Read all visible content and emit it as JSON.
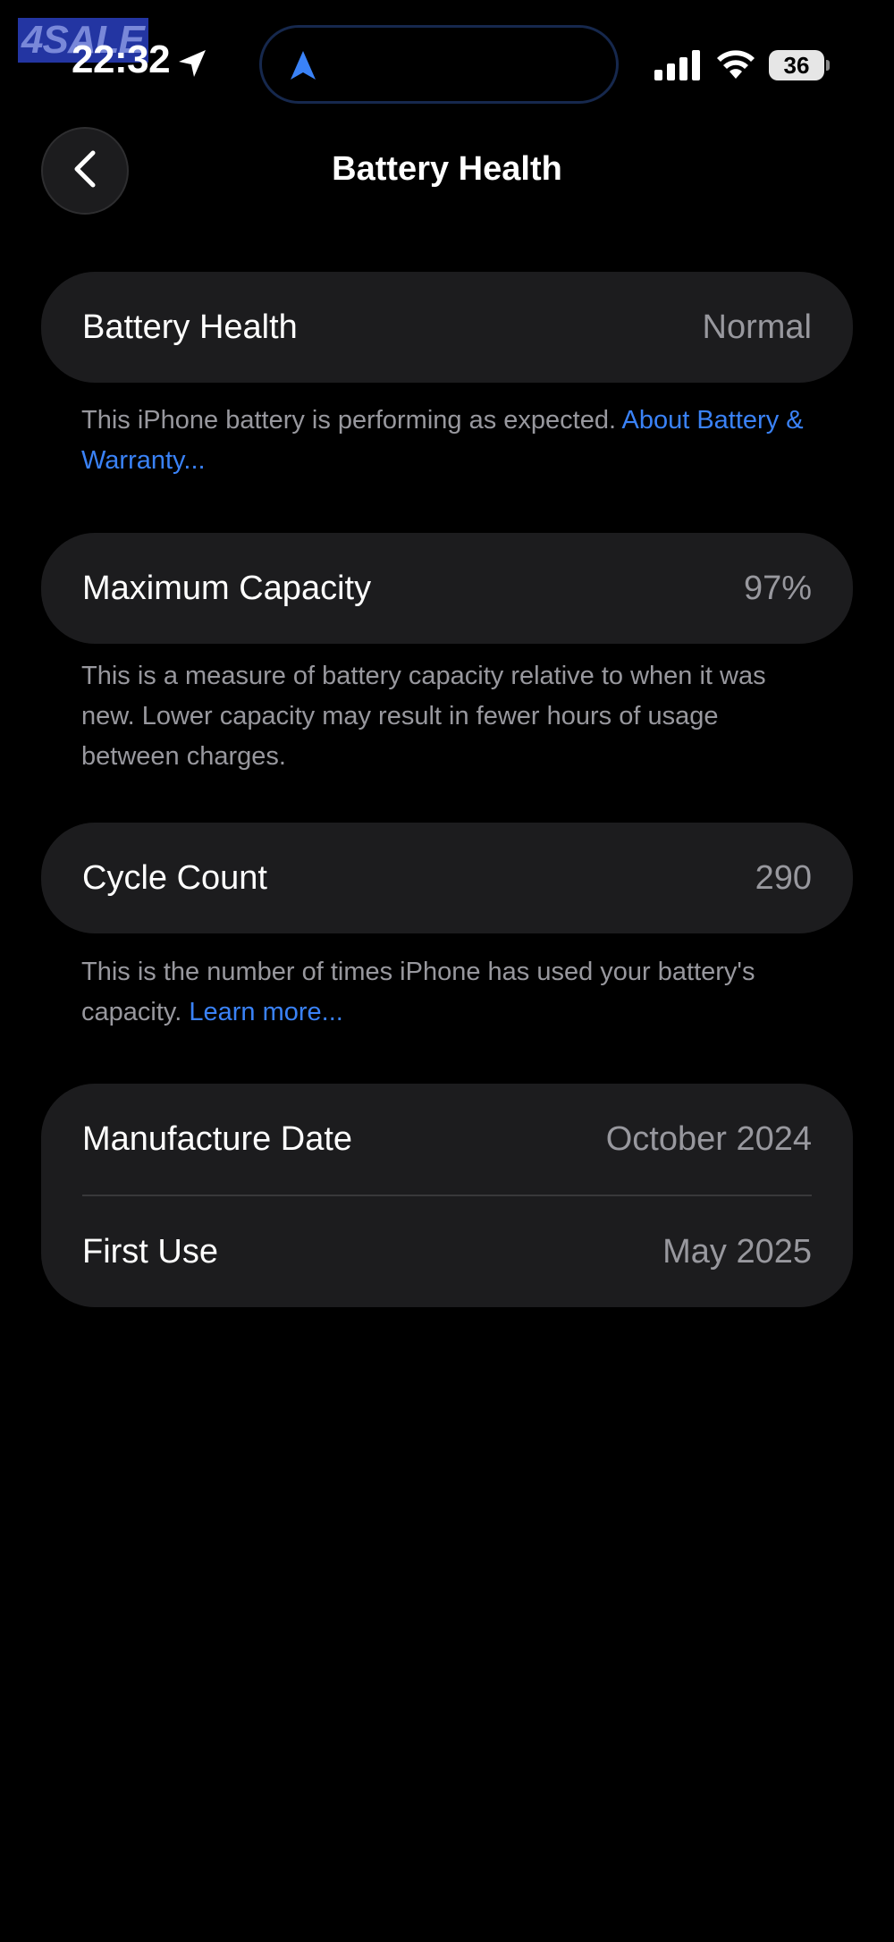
{
  "watermark": {
    "text": "4SALE"
  },
  "status_bar": {
    "time": "22:32",
    "battery_level": "36",
    "location_icon": "location-arrow-icon",
    "island_icon": "navigation-arrow-icon"
  },
  "header": {
    "title": "Battery Health",
    "back_icon": "chevron-left-icon"
  },
  "battery_health": {
    "label": "Battery Health",
    "value": "Normal",
    "note_text": "This iPhone battery is performing as expected. ",
    "note_link": "About Battery & Warranty..."
  },
  "maximum_capacity": {
    "label": "Maximum Capacity",
    "value": "97%",
    "note_text": "This is a measure of battery capacity relative to when it was new. Lower capacity may result in fewer hours of usage between charges."
  },
  "cycle_count": {
    "label": "Cycle Count",
    "value": "290",
    "note_text": "This is the number of times iPhone has used your battery's capacity. ",
    "note_link": "Learn more..."
  },
  "dates": {
    "manufacture_label": "Manufacture Date",
    "manufacture_value": "October 2024",
    "first_use_label": "First Use",
    "first_use_value": "May 2025"
  },
  "colors": {
    "background": "#000000",
    "card": "#1c1c1e",
    "secondary_text": "#98989e",
    "link": "#3a82f7"
  }
}
